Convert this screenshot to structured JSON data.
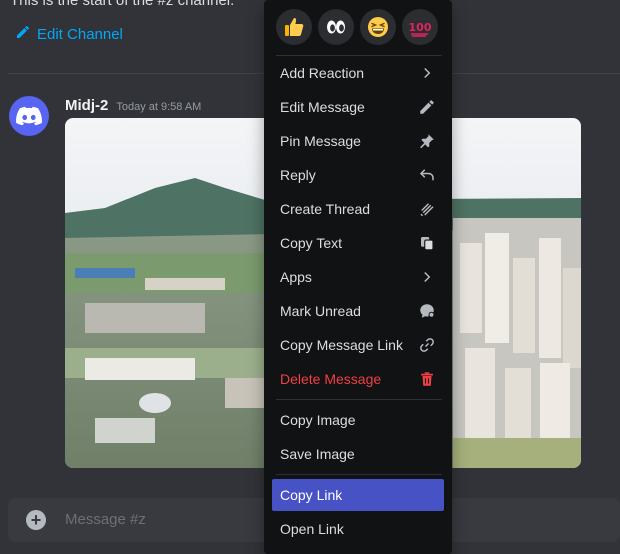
{
  "channel": {
    "intro_text": "This is the start of the #z channel.",
    "edit_label": "Edit Channel"
  },
  "message": {
    "author": "Midj-2",
    "timestamp": "Today at 9:58 AM"
  },
  "composer": {
    "placeholder": "Message #z"
  },
  "context_menu": {
    "reactions": [
      "thumbs-up",
      "eyes",
      "grinning-squinting-face",
      "hundred-points"
    ],
    "items": [
      {
        "label": "Add Reaction",
        "icon": "chevron-right-icon"
      },
      {
        "label": "Edit Message",
        "icon": "pencil-icon"
      },
      {
        "label": "Pin Message",
        "icon": "pin-icon"
      },
      {
        "label": "Reply",
        "icon": "reply-icon"
      },
      {
        "label": "Create Thread",
        "icon": "thread-icon"
      },
      {
        "label": "Copy Text",
        "icon": "copy-icon"
      },
      {
        "label": "Apps",
        "icon": "chevron-right-icon"
      },
      {
        "label": "Mark Unread",
        "icon": "mark-unread-icon"
      },
      {
        "label": "Copy Message Link",
        "icon": "link-icon"
      },
      {
        "label": "Delete Message",
        "icon": "trash-icon"
      },
      {
        "label": "Copy Image",
        "icon": ""
      },
      {
        "label": "Save Image",
        "icon": ""
      },
      {
        "label": "Copy Link",
        "icon": ""
      },
      {
        "label": "Open Link",
        "icon": ""
      }
    ]
  },
  "colors": {
    "background": "#313338",
    "menu_bg": "#111214",
    "link": "#00a8fc",
    "danger": "#f23f43",
    "highlight": "#4752c4",
    "brand": "#5865f2"
  }
}
